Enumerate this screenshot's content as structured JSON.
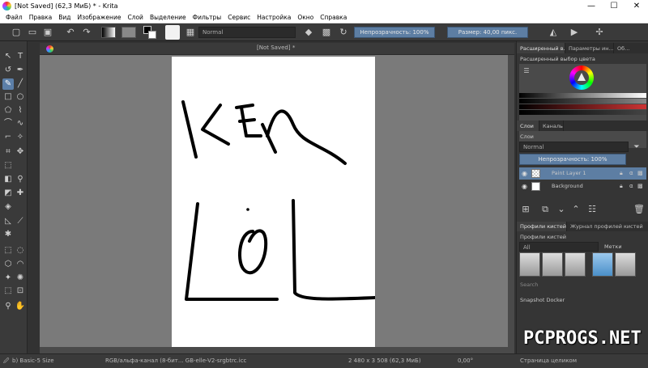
{
  "window": {
    "title": "[Not Saved]  (62,3 МиБ)  * - Krita",
    "minimize": "—",
    "maximize": "☐",
    "close": "✕"
  },
  "menu": [
    "Файл",
    "Правка",
    "Вид",
    "Изображение",
    "Слой",
    "Выделение",
    "Фильтры",
    "Сервис",
    "Настройка",
    "Окно",
    "Справка"
  ],
  "toolbar": {
    "blend_mode": "Normal",
    "opacity_label": "Непрозрачность: 100%",
    "size_label": "Размер: 40,00 пикс."
  },
  "document": {
    "tab_title": "[Not Saved]",
    "tab_modified": "*"
  },
  "dockers": {
    "top_tabs": [
      "Расширенный в...",
      "Параметры ин...",
      "Об..."
    ],
    "color_selector_title": "Расширенный выбор цвета",
    "layer_tabs": [
      "Слои",
      "Каналы"
    ],
    "layers_title": "Слои",
    "layer_blend": "Normal",
    "layer_opacity": "Непрозрачность: 100%",
    "layers": [
      {
        "name": "Paint Layer 1",
        "selected": true
      },
      {
        "name": "Background",
        "selected": false
      }
    ],
    "brush_tabs": [
      "Профили кистей",
      "Журнал профилей кистей"
    ],
    "brush_presets_title": "Профили кистей",
    "brush_filter": "All",
    "brush_tag_label": "Метки",
    "search_placeholder": "Search",
    "snapshot_title": "Snapshot Docker"
  },
  "status": {
    "brush": "b) Basic-5 Size",
    "color_space": "RGB/альфа-канал (8-бит... GB-elle-V2-srgbtrc.icc",
    "image_size": "2 480 x 3 508 (62,3 МиБ)",
    "rotation": "0,00°",
    "zoom": "Страница целиком"
  },
  "watermark": "PCPROGS.NET",
  "colors": {
    "accent": "#5d7ea3",
    "canvas_bg": "#7a7a7a",
    "panel": "#353535"
  }
}
